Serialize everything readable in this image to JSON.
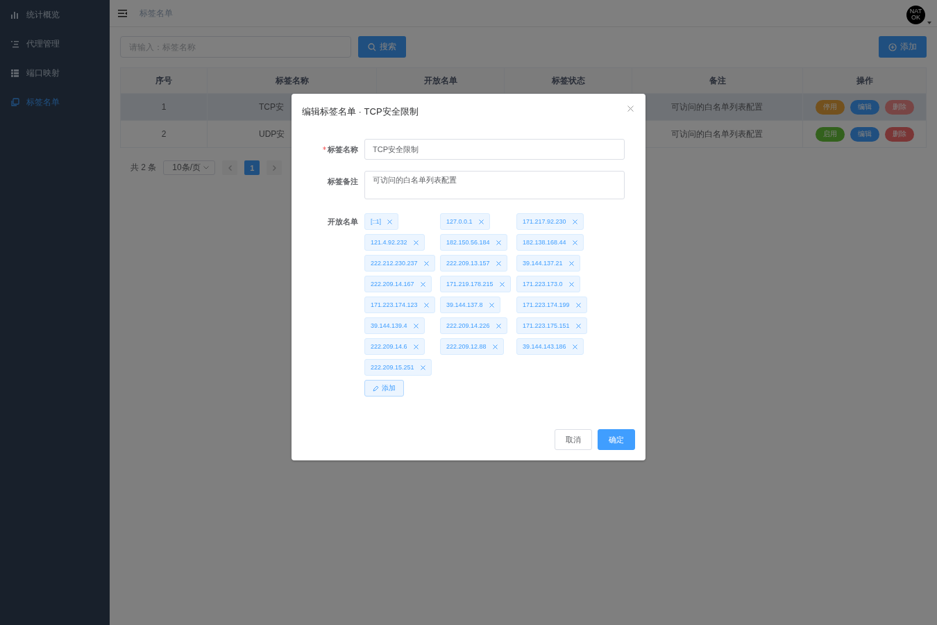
{
  "sidebar": {
    "items": [
      {
        "label": "统计概览",
        "selected": false
      },
      {
        "label": "代理管理",
        "selected": false
      },
      {
        "label": "端口映射",
        "selected": false
      },
      {
        "label": "标签名单",
        "selected": true
      }
    ]
  },
  "header": {
    "breadcrumb": "标签名单",
    "avatar_lines": [
      "NAT",
      "OK"
    ]
  },
  "toolbar": {
    "search": {
      "placeholder": "请输入：标签名称"
    },
    "search_button": "搜索",
    "add_button": "添加"
  },
  "table": {
    "columns": [
      "序号",
      "标签名称",
      "开放名单",
      "标签状态",
      "备注",
      "操作"
    ],
    "rows": [
      {
        "highlighted": true,
        "cells": [
          "1",
          "TCP安",
          "",
          "",
          "可访问的白名单列表配置"
        ],
        "actions": [
          {
            "label": "停用",
            "kind": "warning",
            "disabled": false
          },
          {
            "label": "编辑",
            "kind": "primary",
            "disabled": false
          },
          {
            "label": "删除",
            "kind": "danger",
            "disabled": true
          }
        ]
      },
      {
        "highlighted": false,
        "cells": [
          "2",
          "UDP安",
          "",
          "",
          "可访问的白名单列表配置"
        ],
        "actions": [
          {
            "label": "启用",
            "kind": "success",
            "disabled": false
          },
          {
            "label": "编辑",
            "kind": "primary",
            "disabled": false
          },
          {
            "label": "删除",
            "kind": "danger",
            "disabled": false
          }
        ]
      }
    ]
  },
  "pagination": {
    "total": "共 2 条",
    "page_size": "10条/页",
    "pages": [
      {
        "label": "1",
        "selected": true
      }
    ]
  },
  "dialog": {
    "title": "编辑标签名单 · TCP安全限制",
    "name_field": {
      "label": "标签名称",
      "required": true,
      "value": "TCP安全限制"
    },
    "remark_field": {
      "label": "标签备注",
      "value": "可访问的白名单列表配置"
    },
    "whitelist": {
      "label": "开放名单",
      "tags": [
        "[::1]",
        "127.0.0.1",
        "171.217.92.230",
        "121.4.92.232",
        "182.150.56.184",
        "182.138.168.44",
        "222.212.230.237",
        "222.209.13.157",
        "39.144.137.21",
        "222.209.14.167",
        "171.219.178.215",
        "171.223.173.0",
        "171.223.174.123",
        "39.144.137.8",
        "171.223.174.199",
        "39.144.139.4",
        "222.209.14.226",
        "171.223.175.151",
        "222.209.14.6",
        "222.209.12.88",
        "39.144.143.186",
        "222.209.15.251"
      ],
      "add_button": "添加"
    },
    "buttons": [
      {
        "label": "取消",
        "kind": "default"
      },
      {
        "label": "确定",
        "kind": "primary"
      }
    ]
  }
}
